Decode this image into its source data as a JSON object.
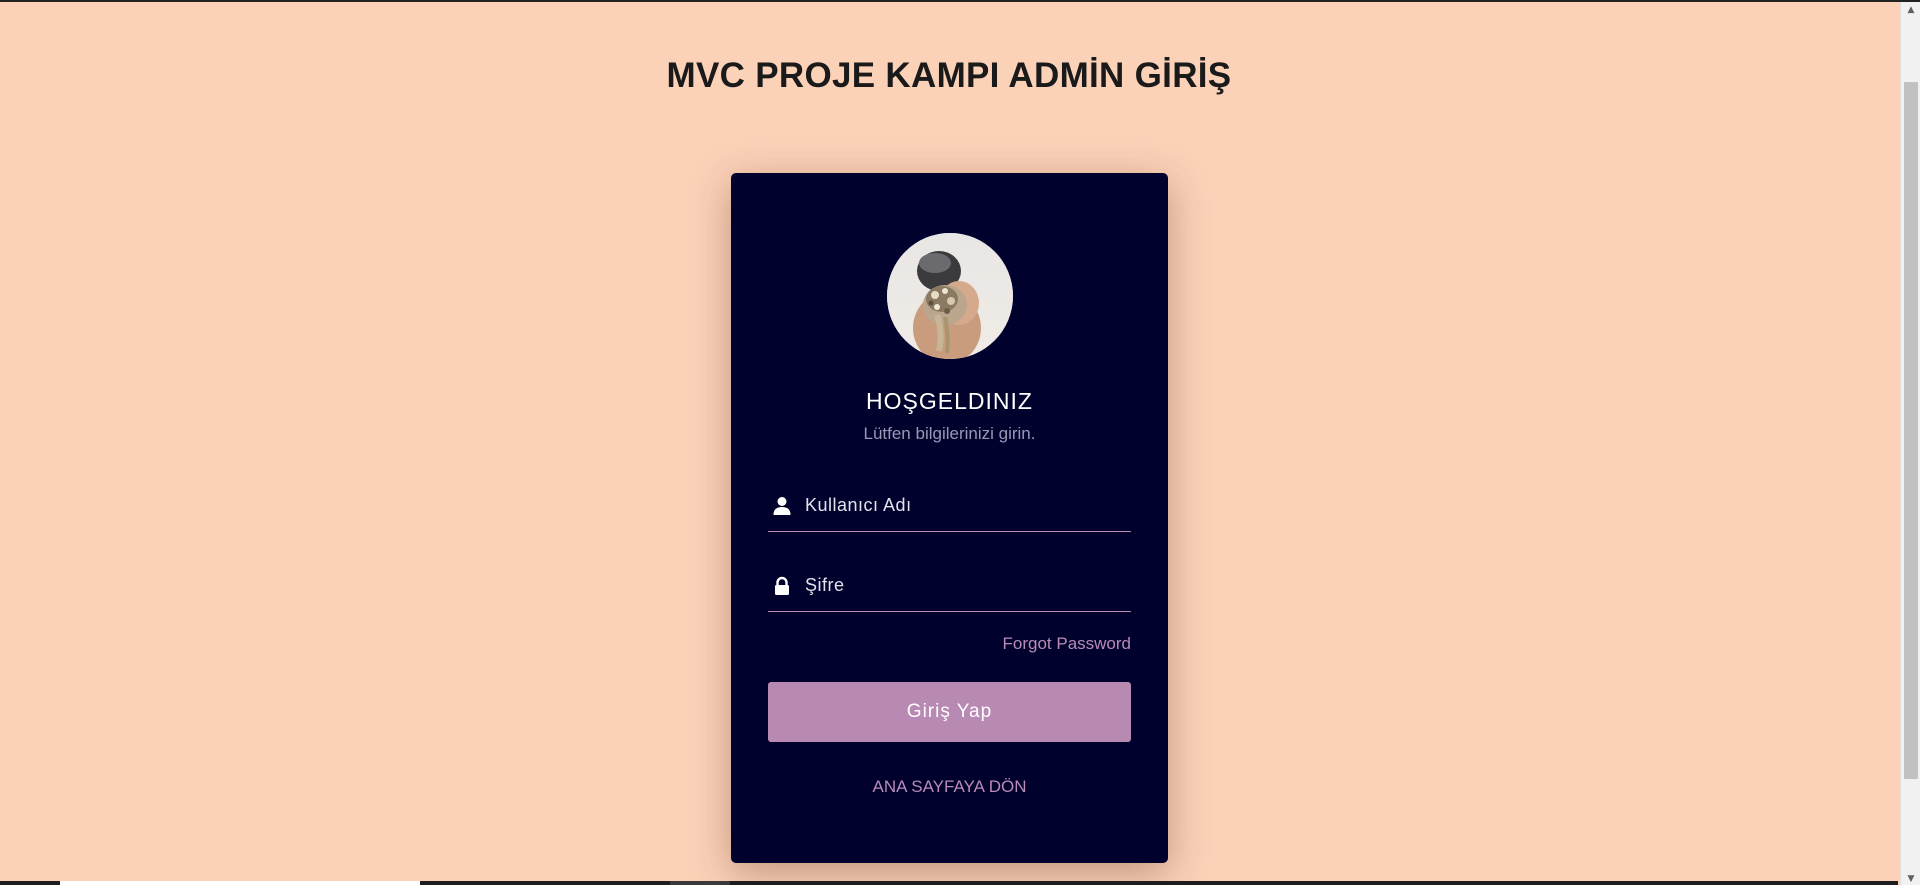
{
  "page": {
    "title": "MVC PROJE KAMPI ADMİN GİRİŞ"
  },
  "login_card": {
    "heading": "HOŞGELDINIZ",
    "subtitle": "Lütfen bilgilerinizi girin.",
    "username_placeholder": "Kullanıcı Adı",
    "username_value": "",
    "username_icon": "user-icon",
    "password_placeholder": "Şifre",
    "password_value": "",
    "password_icon": "lock-icon",
    "forgot_label": "Forgot Password",
    "submit_label": "Giriş Yap",
    "home_link_label": "ANA SAYFAYA DÖN"
  },
  "colors": {
    "page_background": "#fbd1b8",
    "card_background": "#01012e",
    "accent": "#b88ab3",
    "text_light": "#ffffff",
    "text_muted": "#9a98b4"
  }
}
